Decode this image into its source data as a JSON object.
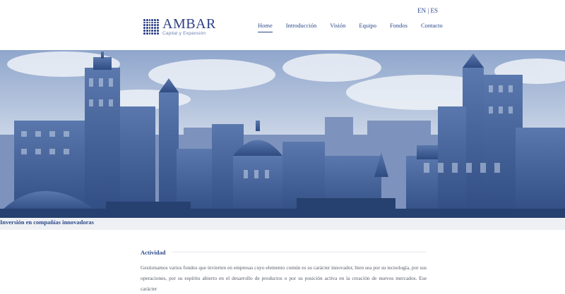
{
  "header": {
    "lang": {
      "en": "EN",
      "sep": "|",
      "es": "ES"
    },
    "logo": {
      "title": "AMBAR",
      "subtitle": "Capital y Expansión"
    },
    "nav": [
      {
        "label": "Home",
        "active": true
      },
      {
        "label": "Introducción",
        "active": false
      },
      {
        "label": "Visión",
        "active": false
      },
      {
        "label": "Equipo",
        "active": false
      },
      {
        "label": "Fondos",
        "active": false
      },
      {
        "label": "Contacto",
        "active": false
      }
    ]
  },
  "hero": {
    "tagline": "Inversión en compañías innovadoras"
  },
  "section": {
    "title": "Actividad",
    "body": "Gestionamos varios fondos que invierten en empresas cuyo elemento común es su carácter innovador, bien sea por su tecnología, por sus operaciones, por su espíritu abierto en el desarrollo de productos o por su posición activa en la creación de nuevos mercados. Ese carácter"
  },
  "colors": {
    "brand": "#2c3f86",
    "link": "#2c4a8a",
    "text": "#555a66",
    "sky": "#b9c7de",
    "buildings": "#3c5a92"
  }
}
